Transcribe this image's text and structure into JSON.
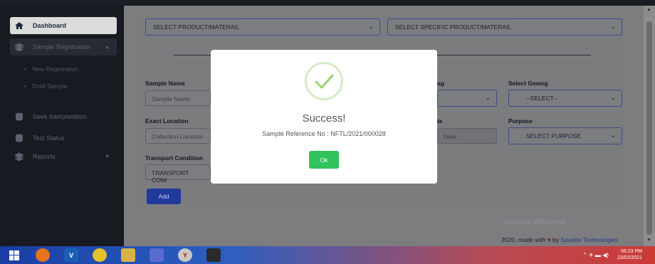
{
  "sidebar": {
    "items": [
      {
        "label": "Dashboard"
      },
      {
        "label": "Sample Registration"
      },
      {
        "label": "Seek Interpretation"
      },
      {
        "label": "Test Status"
      },
      {
        "label": "Reports"
      }
    ],
    "subitems": [
      {
        "label": "New Registration"
      },
      {
        "label": "Draft Sample"
      }
    ]
  },
  "form": {
    "product_select": "SELECT PRODUCT/MATERAIL",
    "specific_select": "SELECT SPECIFIC PRODUCT/MATERAIL",
    "sample_name_label": "Sample Name",
    "sample_name_placeholder": "Sample Name",
    "dzongkhag_label_partial": "ag",
    "gewog_label": "Select Gewog",
    "gewog_select": "--SELECT--",
    "exact_location_label": "Exact Location",
    "location_placeholder": "Collection Location",
    "date_label_partial": "te",
    "date_placeholder_partial": "Date",
    "purpose_label": "Purpose",
    "purpose_select": "SELECT PURPOSE",
    "transport_label": "Transport Condition",
    "transport_select": "TRANSPORT CONI",
    "add_button": "Add"
  },
  "dialog": {
    "title": "Success!",
    "message": "Sample Reference No : NFTL/2021/000028",
    "ok_label": "Ok"
  },
  "watermark": "Activate Windows",
  "footer": {
    "prefix": "2020, made with",
    "by": "by",
    "company": "Sparkle Technologies"
  },
  "taskbar": {
    "time": "06:23 PM",
    "date": "23/02/2021"
  },
  "colors": {
    "success_green": "#31c25c",
    "primary_blue": "#22399c",
    "sidebar_bg": "#171a21"
  }
}
